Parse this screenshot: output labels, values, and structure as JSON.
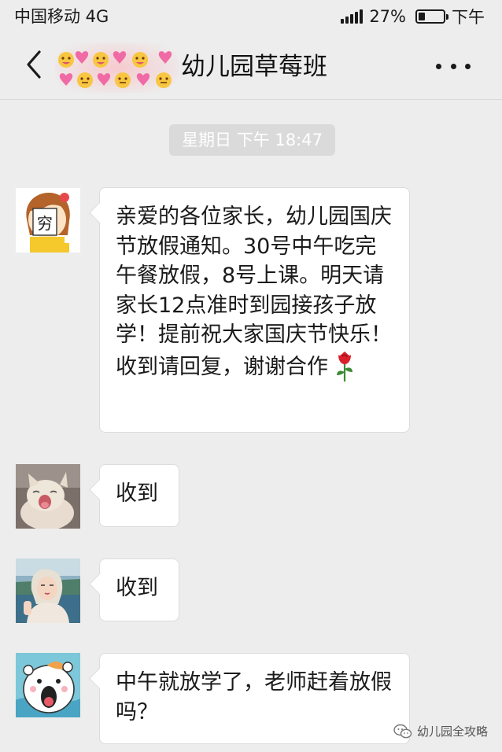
{
  "status_bar": {
    "carrier": "中国移动 4G",
    "battery_text": "27%",
    "battery_level": 0.27,
    "time": "下午"
  },
  "header": {
    "title": "幼儿园草莓班",
    "back_icon": "back-chevron-icon",
    "more_icon": "more-dots-icon",
    "decoration_icon": "emoji-stickers-icon"
  },
  "timestamp": "星期日 下午 18:47",
  "messages": [
    {
      "text": "亲爱的各位家长，幼儿园国庆节放假通知。30号中午吃完午餐放假，8号上课。明天请家长12点准时到园接孩子放学！提前祝大家国庆节快乐！收到请回复，谢谢合作",
      "emoji": "rose-icon",
      "avatar": "cartoon-girl-avatar"
    },
    {
      "text": "收到",
      "avatar": "yawning-cat-avatar"
    },
    {
      "text": "收到",
      "avatar": "girl-photo-avatar"
    },
    {
      "text": "中午就放学了，老师赶着放假吗？",
      "avatar": "cartoon-hamster-avatar"
    }
  ],
  "watermark": "幼儿园全攻略",
  "colors": {
    "background": "#ededed",
    "bubble": "#ffffff",
    "timestamp_bg": "#dadada"
  }
}
